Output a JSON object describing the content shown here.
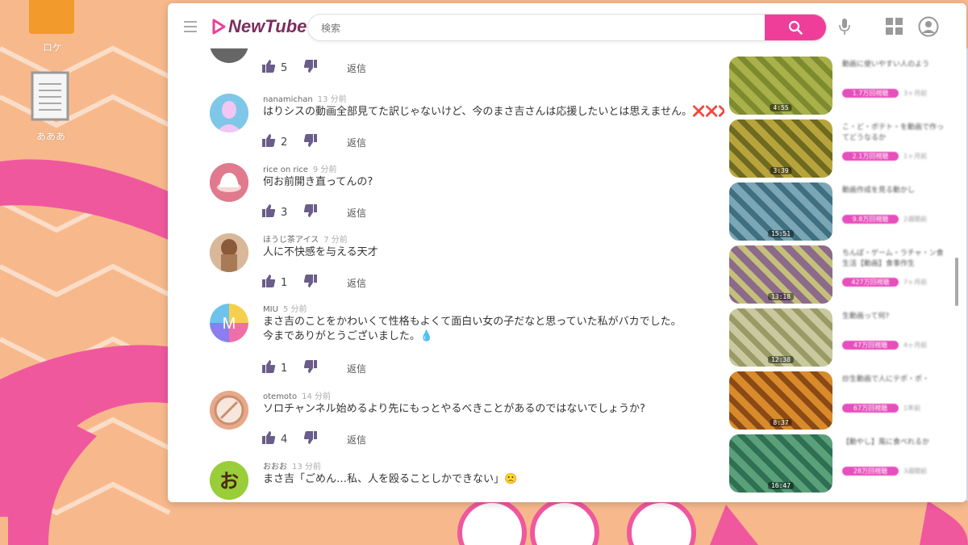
{
  "desktop": {
    "icons": [
      {
        "label": "ロケ",
        "icon": "folder-icon"
      },
      {
        "label": "あああ",
        "icon": "document-icon"
      }
    ]
  },
  "app": {
    "logo_text": "NewTube",
    "search_placeholder": "検索",
    "brand_color": "#ef3e9a"
  },
  "comments": [
    {
      "user": "",
      "time": "",
      "text": "",
      "likes": "5",
      "reply": "返信"
    },
    {
      "user": "nanamichan",
      "time": "13 分前",
      "text": "はりシスの動画全部見てた訳じゃないけど、今のまさ吉さんは応援したいとは思えません。",
      "emoji": "❌❌❌",
      "likes": "2",
      "reply": "返信"
    },
    {
      "user": "rice on rice",
      "time": "9 分前",
      "text": "何お前開き直ってんの?",
      "likes": "3",
      "reply": "返信"
    },
    {
      "user": "ほうじ茶アイス",
      "time": "7 分前",
      "text": "人に不快感を与える天才",
      "likes": "1",
      "reply": "返信"
    },
    {
      "user": "MIU",
      "time": "5 分前",
      "text": "まさ吉のことをかわいくて性格もよくて面白い女の子だなと思っていた私がバカでした。",
      "text2": "今までありがとうございました。💧",
      "likes": "1",
      "reply": "返信",
      "avatar_letter": "M"
    },
    {
      "user": "otemoto",
      "time": "14 分前",
      "text": "ソロチャンネル始めるより先にもっとやるべきことがあるのではないでしょうか?",
      "likes": "4",
      "reply": "返信"
    },
    {
      "user": "おおお",
      "time": "13 分前",
      "text": "まさ吉「ごめん…私、人を殴ることしかできない」🙁",
      "likes": "",
      "reply": "",
      "avatar_letter": "お"
    }
  ],
  "videos": [
    {
      "duration": "4:55",
      "color_a": "#a8b14a",
      "color_b": "#7d8a2e",
      "title": "動画に使いやすい人のよう",
      "chip": "1.7万回視聴",
      "sub": "3ヶ月前"
    },
    {
      "duration": "3:39",
      "color_a": "#b8a43c",
      "color_b": "#6e6a20",
      "title": "こ・ど・ポテト・を動画で作ってどうなるか",
      "chip": "2.1万回視聴",
      "sub": "1ヶ月前"
    },
    {
      "duration": "15:51",
      "color_a": "#7aa6b5",
      "color_b": "#3f6f80",
      "title": "動画作成を見る動かし",
      "chip": "9.8万回視聴",
      "sub": "2週間前"
    },
    {
      "duration": "13:18",
      "color_a": "#8c6a8a",
      "color_b": "#c4c07a",
      "title": "ちんぽ・ゲーム・ラチャ・ン食生活【動画】食事作生",
      "chip": "427万回視聴",
      "sub": "7ヶ月前"
    },
    {
      "duration": "12:38",
      "color_a": "#c9c9a0",
      "color_b": "#9a9a66",
      "title": "生動画って何?",
      "chip": "47万回視聴",
      "sub": "4ヶ月前"
    },
    {
      "duration": "8:37",
      "color_a": "#d98a2a",
      "color_b": "#8a4a16",
      "title": "炒生動画で人にテポ・ポ・",
      "chip": "67万回視聴",
      "sub": "1年前"
    },
    {
      "duration": "16:47",
      "color_a": "#5aa07a",
      "color_b": "#2f6f52",
      "title": "【動やし】風に食べれるか",
      "chip": "28万回視聴",
      "sub": "3週間前"
    }
  ]
}
